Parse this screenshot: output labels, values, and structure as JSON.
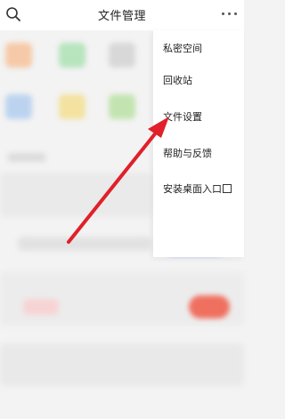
{
  "topbar": {
    "title": "文件管理",
    "search_icon": "search-icon",
    "more_icon": "more-horizontal-icon"
  },
  "menu": {
    "items": [
      {
        "label": "私密空间"
      },
      {
        "label": "回收站"
      },
      {
        "label": "文件设置"
      },
      {
        "label": "帮助与反馈"
      },
      {
        "label": "安装桌面入口"
      }
    ]
  },
  "colors": {
    "arrow": "#e0202a",
    "accent_blue": "#3b7bff",
    "accent_red": "#f07060"
  }
}
